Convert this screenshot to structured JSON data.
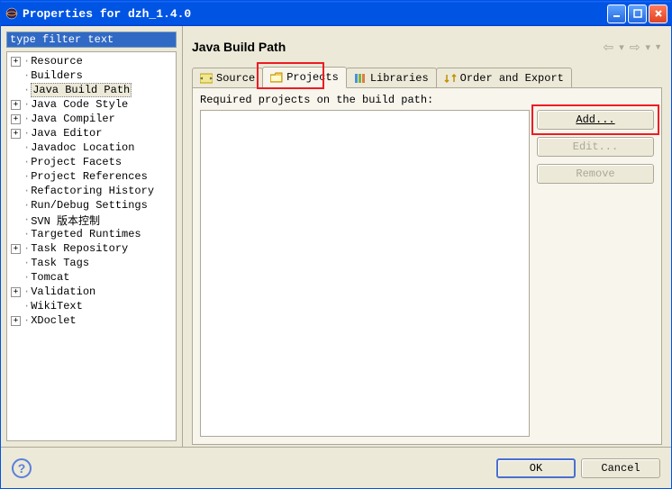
{
  "window": {
    "title": "Properties for dzh_1.4.0"
  },
  "filter": {
    "value": "type filter text"
  },
  "tree": [
    {
      "label": "Resource",
      "expandable": true,
      "level": 0
    },
    {
      "label": "Builders",
      "expandable": false,
      "level": 0
    },
    {
      "label": "Java Build Path",
      "expandable": false,
      "level": 0,
      "selected": true
    },
    {
      "label": "Java Code Style",
      "expandable": true,
      "level": 0
    },
    {
      "label": "Java Compiler",
      "expandable": true,
      "level": 0
    },
    {
      "label": "Java Editor",
      "expandable": true,
      "level": 0
    },
    {
      "label": "Javadoc Location",
      "expandable": false,
      "level": 0
    },
    {
      "label": "Project Facets",
      "expandable": false,
      "level": 0
    },
    {
      "label": "Project References",
      "expandable": false,
      "level": 0
    },
    {
      "label": "Refactoring History",
      "expandable": false,
      "level": 0
    },
    {
      "label": "Run/Debug Settings",
      "expandable": false,
      "level": 0
    },
    {
      "label": "SVN 版本控制",
      "expandable": false,
      "level": 0
    },
    {
      "label": "Targeted Runtimes",
      "expandable": false,
      "level": 0
    },
    {
      "label": "Task Repository",
      "expandable": true,
      "level": 0
    },
    {
      "label": "Task Tags",
      "expandable": false,
      "level": 0
    },
    {
      "label": "Tomcat",
      "expandable": false,
      "level": 0
    },
    {
      "label": "Validation",
      "expandable": true,
      "level": 0
    },
    {
      "label": "WikiText",
      "expandable": false,
      "level": 0
    },
    {
      "label": "XDoclet",
      "expandable": true,
      "level": 0
    }
  ],
  "main": {
    "title": "Java Build Path",
    "tabs": [
      {
        "label": "Source",
        "icon": "source"
      },
      {
        "label": "Projects",
        "icon": "projects",
        "active": true
      },
      {
        "label": "Libraries",
        "icon": "libraries"
      },
      {
        "label": "Order and Export",
        "icon": "order"
      }
    ],
    "content_label": "Required projects on the build path:",
    "buttons": {
      "add": "Add...",
      "edit": "Edit...",
      "remove": "Remove"
    }
  },
  "footer": {
    "ok": "OK",
    "cancel": "Cancel"
  }
}
